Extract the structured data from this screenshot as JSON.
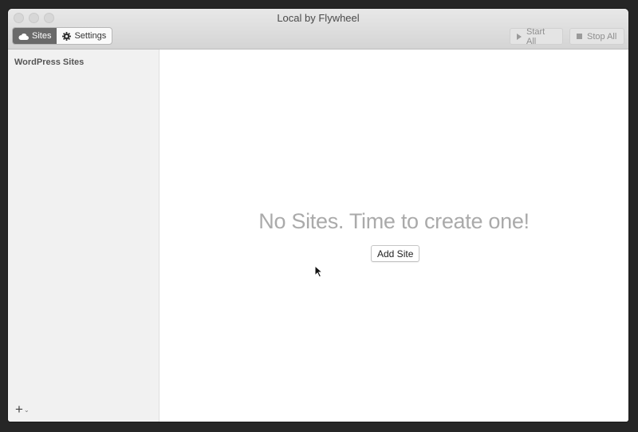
{
  "window": {
    "title": "Local by Flywheel"
  },
  "toolbar": {
    "tabs": [
      {
        "label": "Sites",
        "icon": "cloud-icon",
        "active": true
      },
      {
        "label": "Settings",
        "icon": "gear-icon",
        "active": false
      }
    ],
    "start_all_label": "Start All",
    "stop_all_label": "Stop All"
  },
  "sidebar": {
    "heading": "WordPress Sites",
    "add_label": "+",
    "add_chevron": "⌄"
  },
  "main": {
    "empty_message": "No Sites. Time to create one!",
    "add_site_label": "Add Site"
  }
}
